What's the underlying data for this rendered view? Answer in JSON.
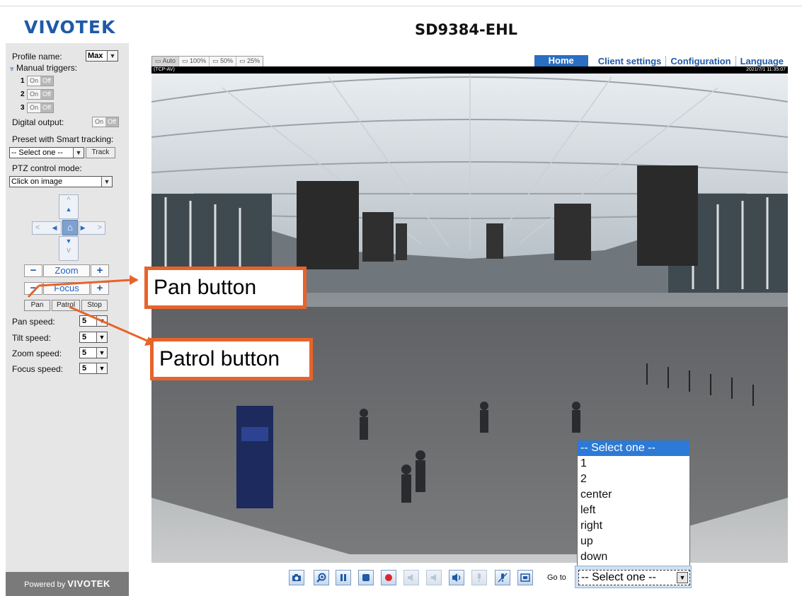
{
  "brand": {
    "logo": "VIVOTEK",
    "model": "SD9384-EHL",
    "footer_prefix": "Powered by",
    "footer_brand": "VIVOTEK"
  },
  "nav": {
    "home": "Home",
    "client_settings": "Client settings",
    "configuration": "Configuration",
    "language": "Language"
  },
  "view_sizes": [
    "Auto",
    "100%",
    "50%",
    "25%"
  ],
  "sidebar": {
    "profile_label": "Profile name:",
    "profile_value": "Max",
    "manual_triggers_label": "Manual triggers:",
    "triggers": [
      "1",
      "2",
      "3"
    ],
    "on_label": "On",
    "off_label": "Off",
    "digital_output_label": "Digital output:",
    "preset_label": "Preset with Smart tracking:",
    "preset_value": "-- Select one --",
    "track_label": "Track",
    "ptz_mode_label": "PTZ control mode:",
    "ptz_mode_value": "Click on image",
    "zoom_label": "Zoom",
    "focus_label": "Focus",
    "minus": "−",
    "plus": "+",
    "pan_label": "Pan",
    "patrol_label": "Patrol",
    "stop_label": "Stop",
    "speeds": [
      {
        "label": "Pan speed:",
        "value": "5"
      },
      {
        "label": "Tilt speed:",
        "value": "5"
      },
      {
        "label": "Zoom speed:",
        "value": "5"
      },
      {
        "label": "Focus speed:",
        "value": "5"
      }
    ]
  },
  "video": {
    "protocol": "(TCP-AV)",
    "timestamp": "2021/7/1 11:35:07"
  },
  "callouts": {
    "pan": "Pan button",
    "patrol": "Patrol button"
  },
  "goto": {
    "label": "Go to",
    "value": "-- Select one --",
    "options": [
      "-- Select one --",
      "1",
      "2",
      "center",
      "left",
      "right",
      "up",
      "down"
    ]
  },
  "colors": {
    "brand_blue": "#1e5aa8",
    "nav_active": "#2a6fc2",
    "callout": "#e8632a",
    "dropdown_highlight": "#2d7ad6"
  }
}
